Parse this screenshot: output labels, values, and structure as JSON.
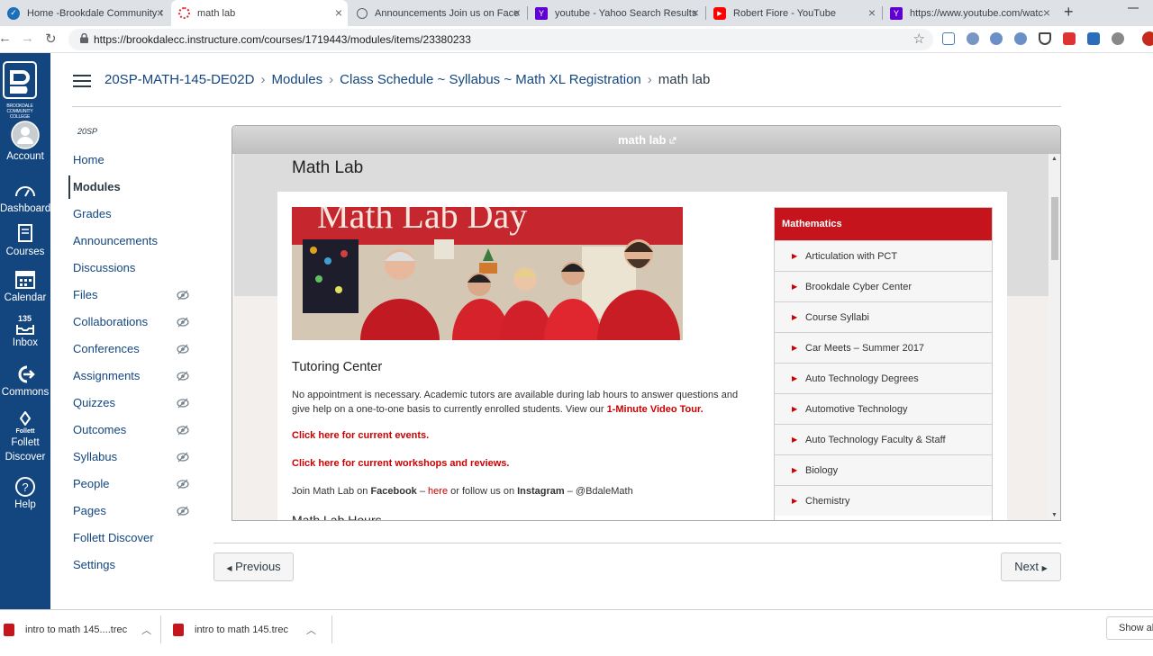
{
  "browser": {
    "tabs": [
      {
        "title": "Home -Brookdale Community C",
        "favicon_color": "#1c6fb8"
      },
      {
        "title": "math lab",
        "favicon_color": "#e0312b"
      },
      {
        "title": "Announcements Join us on Face",
        "favicon_color": "#5f6368"
      },
      {
        "title": "youtube - Yahoo Search Results",
        "favicon_color": "#6001d2"
      },
      {
        "title": "Robert Fiore - YouTube",
        "favicon_color": "#ff0000"
      },
      {
        "title": "https://www.youtube.com/watc",
        "favicon_color": "#6001d2"
      }
    ],
    "url": "https://brookdalecc.instructure.com/courses/1719443/modules/items/23380233",
    "favicon_y": "Y"
  },
  "rail": {
    "logo_text": "BROOKDALE COMMUNITY COLLEGE",
    "items": [
      {
        "label": "Account"
      },
      {
        "label": "Dashboard"
      },
      {
        "label": "Courses"
      },
      {
        "label": "Calendar"
      },
      {
        "label": "Inbox",
        "badge": "135"
      },
      {
        "label": "Commons"
      },
      {
        "label": "Follett Discover",
        "icon_text": "Follett"
      },
      {
        "label": "Help"
      }
    ]
  },
  "breadcrumb": [
    "20SP-MATH-145-DE02D",
    "Modules",
    "Class Schedule ~ Syllabus ~ Math XL Registration",
    "math lab"
  ],
  "course_nav": {
    "term": "20SP",
    "items": [
      {
        "label": "Home",
        "hidden": false
      },
      {
        "label": "Modules",
        "hidden": false
      },
      {
        "label": "Grades",
        "hidden": false
      },
      {
        "label": "Announcements",
        "hidden": false
      },
      {
        "label": "Discussions",
        "hidden": false
      },
      {
        "label": "Files",
        "hidden": true
      },
      {
        "label": "Collaborations",
        "hidden": true
      },
      {
        "label": "Conferences",
        "hidden": true
      },
      {
        "label": "Assignments",
        "hidden": true
      },
      {
        "label": "Quizzes",
        "hidden": true
      },
      {
        "label": "Outcomes",
        "hidden": true
      },
      {
        "label": "Syllabus",
        "hidden": true
      },
      {
        "label": "People",
        "hidden": true
      },
      {
        "label": "Pages",
        "hidden": true
      },
      {
        "label": "Follett Discover",
        "hidden": false
      },
      {
        "label": "Settings",
        "hidden": false
      }
    ],
    "active": "Modules"
  },
  "frame": {
    "header": "math lab",
    "page_title": "Math Lab",
    "banner_text": "Math Lab Day",
    "heading": "Tutoring Center",
    "paragraph": "No appointment is necessary.  Academic tutors are available during lab hours to answer questions and give help on a one-to-one basis to currently enrolled students.  View our ",
    "video_link": "1-Minute Video Tour.",
    "link_events": "Click here for current events.",
    "link_workshops": "Click here for current workshops and reviews.",
    "fb_1": "Join Math Lab on ",
    "fb_facebook": "Facebook",
    "fb_dash": " – ",
    "fb_here": "here",
    "fb_2": " or follow us on ",
    "fb_instagram": "Instagram",
    "fb_3": " –  @BdaleMath",
    "next_heading": "Math Lab Hours"
  },
  "sidebar": {
    "title": "Mathematics",
    "items": [
      "Articulation with PCT",
      "Brookdale Cyber Center",
      "Course Syllabi",
      "Car Meets – Summer 2017",
      "Auto Technology Degrees",
      "Automotive Technology",
      "Auto Technology Faculty & Staff",
      "Biology",
      "Chemistry"
    ]
  },
  "pager": {
    "prev": "Previous",
    "next": "Next"
  },
  "downloads": {
    "items": [
      "intro to math 145....trec",
      "intro to math 145.trec"
    ],
    "show_all": "Show all"
  }
}
